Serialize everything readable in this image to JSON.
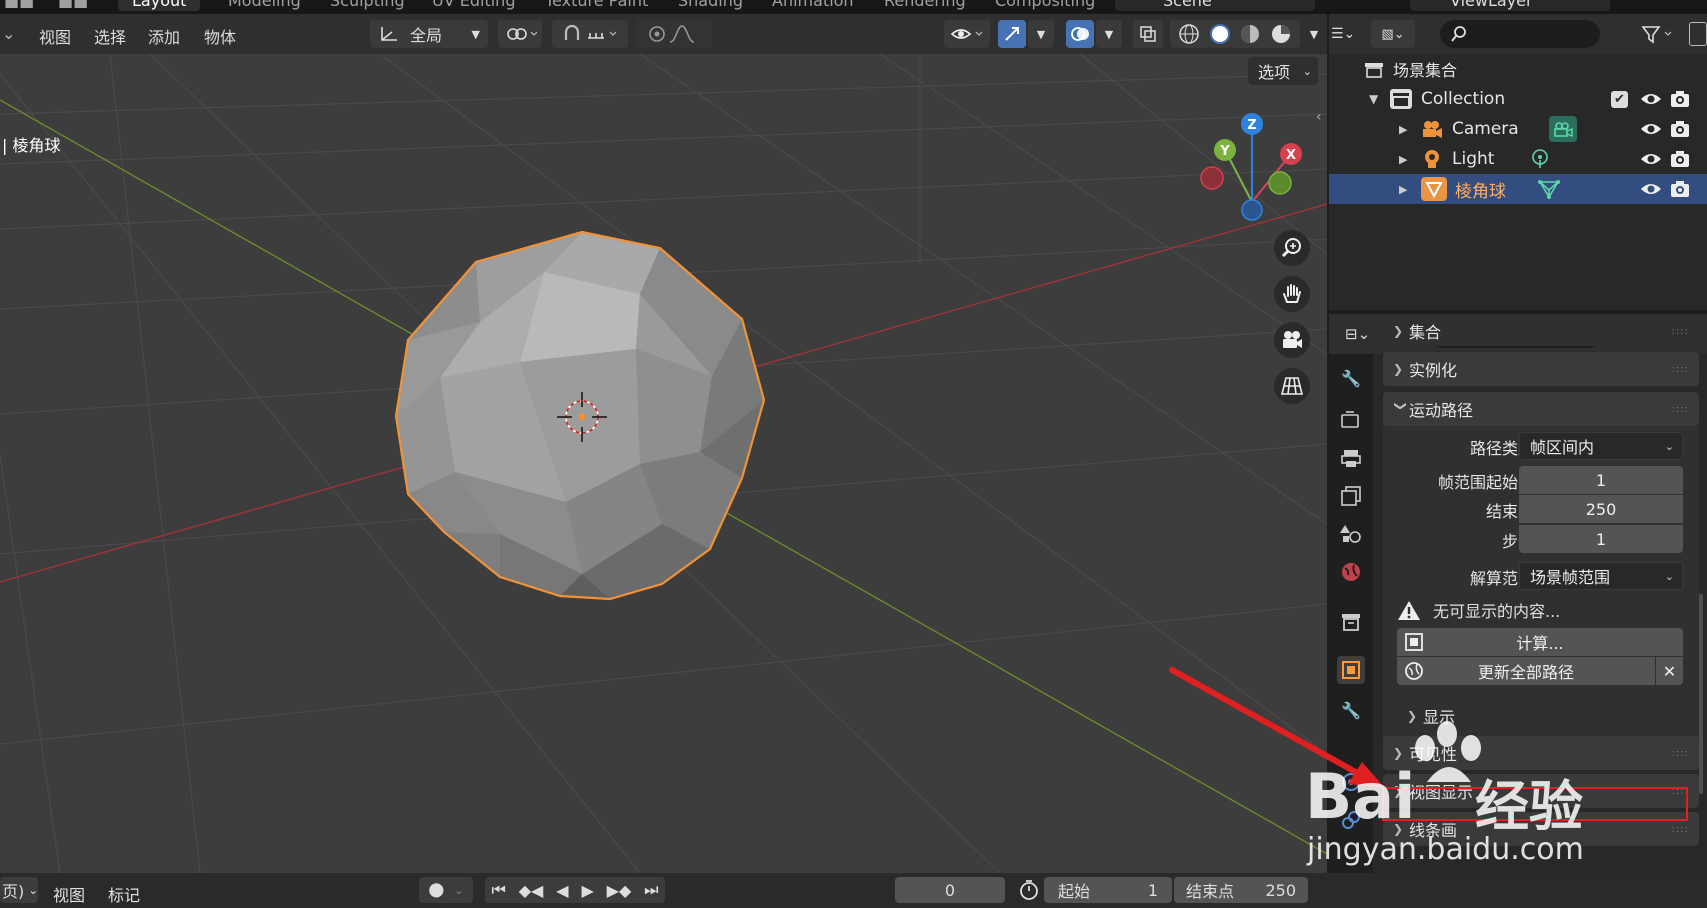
{
  "workspace_tabs": [
    "Layout",
    "Modeling",
    "Sculpting",
    "UV Editing",
    "Texture Paint",
    "Shading",
    "Animation",
    "Rendering",
    "Compositing"
  ],
  "scene_name": "Scene",
  "viewlayer_name": "ViewLayer",
  "viewport_header": {
    "menus": [
      "视图",
      "选择",
      "添加",
      "物体"
    ],
    "transform_orientation": "全局",
    "options_label": "选项"
  },
  "viewport": {
    "object_label": "| 棱角球",
    "gizmo_axes": {
      "x": "X",
      "y": "Y",
      "z": "Z"
    }
  },
  "outliner": {
    "scene_collection": "场景集合",
    "items": [
      {
        "label": "Collection"
      },
      {
        "label": "Camera"
      },
      {
        "label": "Light"
      },
      {
        "label": "棱角球"
      }
    ]
  },
  "properties": {
    "panels": {
      "collections": "集合",
      "instancing": "实例化",
      "motion_paths": "运动路径",
      "display": "显示",
      "visibility": "可见性",
      "viewport_display": "视图显示",
      "line_art": "线条画"
    },
    "motion_paths": {
      "path_type_label": "路径类型",
      "path_type_value": "帧区间内",
      "frame_start_label": "帧范围起始帧",
      "frame_start_value": "1",
      "end_label": "结束点",
      "end_value": "250",
      "step_label": "步长",
      "step_value": "1",
      "calc_range_label": "解算范围",
      "calc_range_value": "场景帧范围",
      "warning": "无可显示的内容...",
      "calculate_button": "计算...",
      "update_all_button": "更新全部路径"
    }
  },
  "timeline": {
    "menus": [
      "视图",
      "标记"
    ],
    "left_partial": "页)",
    "current_frame": "0",
    "start_label": "起始",
    "start_value": "1",
    "end_label": "结束点",
    "end_value": "250"
  },
  "watermark": {
    "brand": "Bai",
    "brand_cn": "经验",
    "url": "jingyan.baidu.com"
  },
  "colors": {
    "selection_orange": "#f0923a",
    "highlight_red": "#e02020",
    "outliner_selected": "#334d80",
    "axis_x": "#d8404e",
    "axis_y": "#7ab33e",
    "axis_z": "#2f83e0"
  }
}
